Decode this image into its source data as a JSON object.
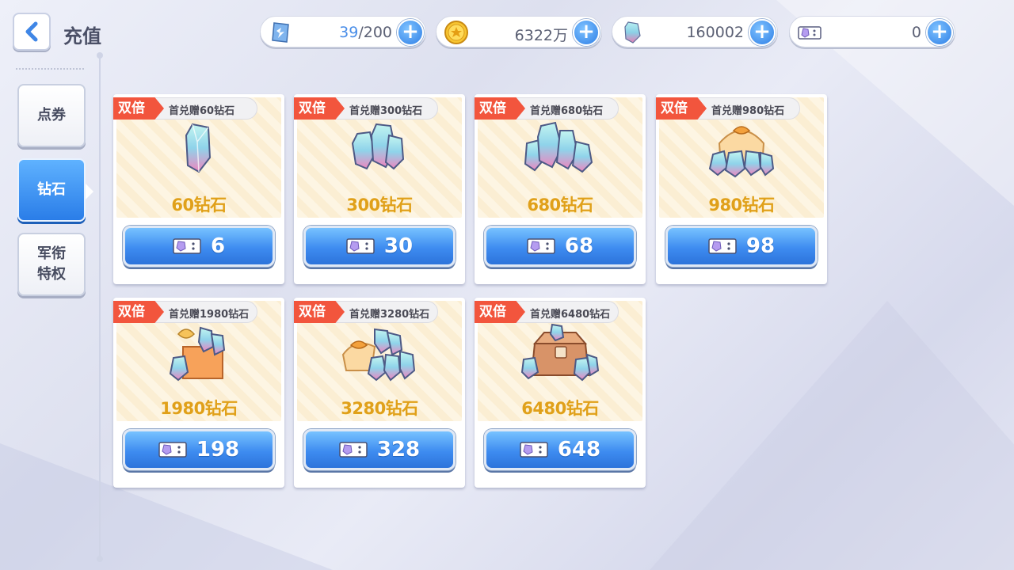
{
  "header": {
    "title": "充值"
  },
  "currencies": [
    {
      "icon": "stamina-icon",
      "value_highlight": "39",
      "value_rest": "/200"
    },
    {
      "icon": "gold-coin-icon",
      "value_highlight": "",
      "value_rest": "6322万"
    },
    {
      "icon": "diamond-icon",
      "value_highlight": "",
      "value_rest": "160002"
    },
    {
      "icon": "ticket-icon",
      "value_highlight": "",
      "value_rest": "0"
    }
  ],
  "sidebar": {
    "items": [
      {
        "label": "点券",
        "active": false
      },
      {
        "label": "钻石",
        "active": true
      },
      {
        "label": "军衔\n特权",
        "active": false
      }
    ]
  },
  "products": [
    {
      "badge": "双倍",
      "bonus": "首兑赠60钻石",
      "name": "60钻石",
      "price": "6",
      "art": "single-diamond-icon"
    },
    {
      "badge": "双倍",
      "bonus": "首兑赠300钻石",
      "name": "300钻石",
      "price": "30",
      "art": "diamond-pair-icon"
    },
    {
      "badge": "双倍",
      "bonus": "首兑赠680钻石",
      "name": "680钻石",
      "price": "68",
      "art": "diamond-cluster-icon"
    },
    {
      "badge": "双倍",
      "bonus": "首兑赠980钻石",
      "name": "980钻石",
      "price": "98",
      "art": "diamond-bag-icon"
    },
    {
      "badge": "双倍",
      "bonus": "首兑赠1980钻石",
      "name": "1980钻石",
      "price": "198",
      "art": "diamond-box-icon"
    },
    {
      "badge": "双倍",
      "bonus": "首兑赠3280钻石",
      "name": "3280钻石",
      "price": "328",
      "art": "diamond-gift-pile-icon"
    },
    {
      "badge": "双倍",
      "bonus": "首兑赠6480钻石",
      "name": "6480钻石",
      "price": "648",
      "art": "diamond-chest-icon"
    }
  ],
  "colors": {
    "accent_blue": "#3e8cf0",
    "badge_red": "#f2553d",
    "gold_text": "#e0a01a"
  }
}
